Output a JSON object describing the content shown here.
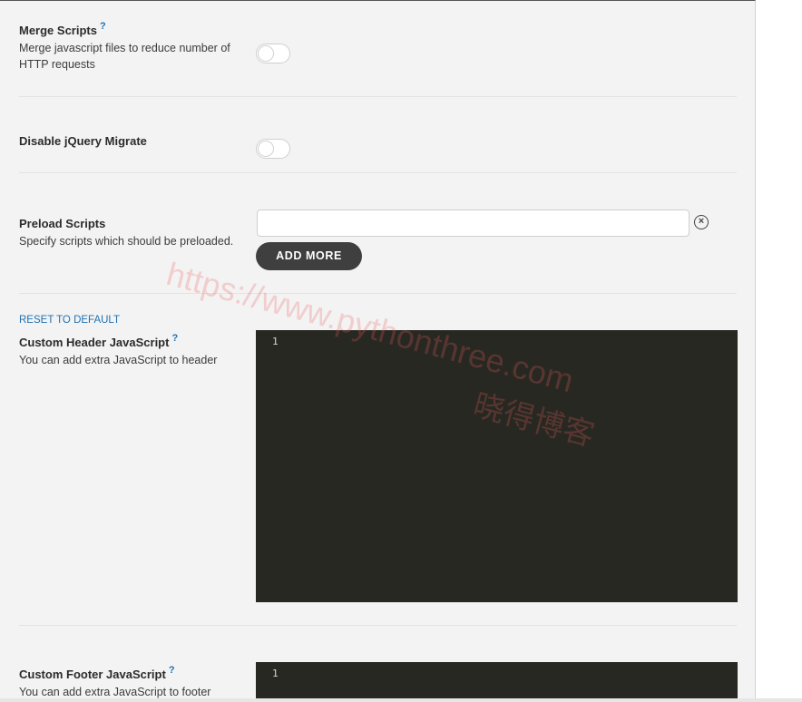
{
  "merge_scripts": {
    "title": "Merge Scripts",
    "help": "?",
    "description": "Merge javascript files to reduce number of HTTP requests",
    "enabled": false
  },
  "disable_jquery_migrate": {
    "title": "Disable jQuery Migrate",
    "enabled": false
  },
  "preload_scripts": {
    "title": "Preload Scripts",
    "description": "Specify scripts which should be preloaded.",
    "input_value": "",
    "clear_icon": "⊗",
    "add_more_label": "ADD MORE"
  },
  "custom_header_js": {
    "reset_label": "RESET TO DEFAULT",
    "title": "Custom Header JavaScript",
    "help": "?",
    "description": "You can add extra JavaScript to header",
    "line_number": "1"
  },
  "custom_footer_js": {
    "title": "Custom Footer JavaScript",
    "help": "?",
    "description": "You can add extra JavaScript to footer",
    "line_number": "1"
  },
  "watermark": {
    "url": "https://www.pythonthree.com",
    "name": "晓得博客"
  },
  "colors": {
    "accent": "#2271b1",
    "editor_bg": "#272822",
    "button_bg": "#3f3f3f"
  }
}
